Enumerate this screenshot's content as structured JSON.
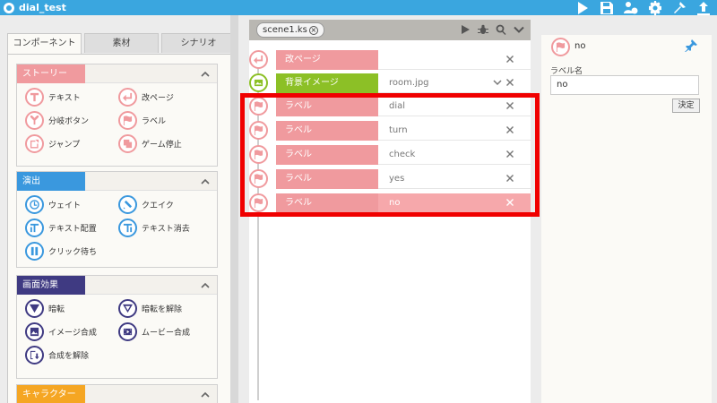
{
  "app": {
    "title": "dial_test",
    "toolbar_icons": [
      "play-icon",
      "save-icon",
      "users-gear-icon",
      "settings-icon",
      "build-icon",
      "export-icon"
    ]
  },
  "left": {
    "tabs": [
      "コンポーネント",
      "素材",
      "シナリオ"
    ],
    "active_tab": 0,
    "sections": [
      {
        "title": "ストーリー",
        "color": "#f09a9e",
        "items": [
          {
            "label": "テキスト",
            "icon": "text-icon"
          },
          {
            "label": "改ページ",
            "icon": "page-break-icon"
          },
          {
            "label": "分岐ボタン",
            "icon": "branch-icon"
          },
          {
            "label": "ラベル",
            "icon": "flag-icon"
          },
          {
            "label": "ジャンプ",
            "icon": "jump-icon"
          },
          {
            "label": "ゲーム停止",
            "icon": "stop-icon"
          }
        ]
      },
      {
        "title": "演出",
        "color": "#3a98de",
        "items": [
          {
            "label": "ウェイト",
            "icon": "clock-icon"
          },
          {
            "label": "クエイク",
            "icon": "quake-icon"
          },
          {
            "label": "テキスト配置",
            "icon": "text-place-icon"
          },
          {
            "label": "テキスト消去",
            "icon": "text-clear-icon"
          },
          {
            "label": "クリック待ち",
            "icon": "pause-icon"
          }
        ]
      },
      {
        "title": "画面効果",
        "color": "#3f3a82",
        "items": [
          {
            "label": "暗転",
            "icon": "fade-out-icon"
          },
          {
            "label": "暗転を解除",
            "icon": "fade-in-icon"
          },
          {
            "label": "イメージ合成",
            "icon": "image-composite-icon"
          },
          {
            "label": "ムービー合成",
            "icon": "movie-composite-icon"
          },
          {
            "label": "合成を解除",
            "icon": "composite-clear-icon"
          }
        ]
      },
      {
        "title": "キャラクター",
        "color": "#f5a623",
        "items": []
      }
    ]
  },
  "scene": {
    "tab_label": "scene1.ks",
    "tools": [
      "play-icon",
      "bug-icon",
      "search-icon",
      "chevron-down-icon"
    ],
    "rows": [
      {
        "tag": "改ページ",
        "value": "",
        "color": "#f09a9e",
        "icon": "page-break-icon",
        "dropdown": false,
        "selected": false
      },
      {
        "tag": "背景イメージ",
        "value": "room.jpg",
        "color": "#8cc026",
        "icon": "bg-image-icon",
        "dropdown": true,
        "selected": false
      },
      {
        "tag": "ラベル",
        "value": "dial",
        "color": "#f09a9e",
        "icon": "flag-icon",
        "dropdown": false,
        "selected": false
      },
      {
        "tag": "ラベル",
        "value": "turn",
        "color": "#f09a9e",
        "icon": "flag-icon",
        "dropdown": false,
        "selected": false
      },
      {
        "tag": "ラベル",
        "value": "check",
        "color": "#f09a9e",
        "icon": "flag-icon",
        "dropdown": false,
        "selected": false
      },
      {
        "tag": "ラベル",
        "value": "yes",
        "color": "#f09a9e",
        "icon": "flag-icon",
        "dropdown": false,
        "selected": false
      },
      {
        "tag": "ラベル",
        "value": "no",
        "color": "#f09a9e",
        "icon": "flag-icon",
        "dropdown": false,
        "selected": true
      }
    ]
  },
  "inspector": {
    "name": "no",
    "field_label": "ラベル名",
    "field_value": "no",
    "confirm_label": "決定"
  },
  "colors": {
    "titlebar": "#3aa6df",
    "highlight": "#f00000"
  }
}
